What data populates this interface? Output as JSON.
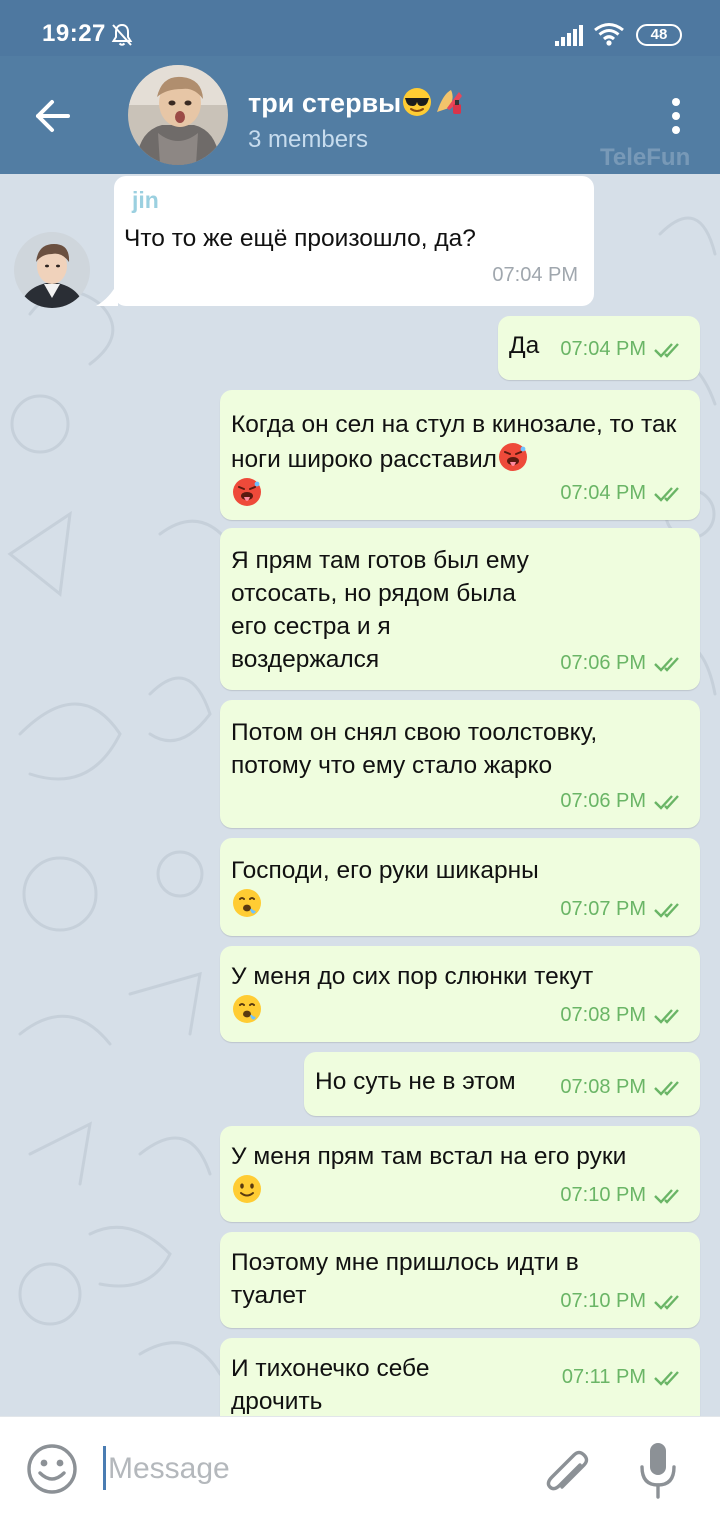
{
  "status_bar": {
    "time": "19:27",
    "battery": "48",
    "icons": [
      "bell-off-icon",
      "signal-icon",
      "wifi-icon",
      "battery-icon"
    ]
  },
  "header": {
    "title": "три стервы",
    "title_emojis": [
      "sunglasses-emoji",
      "nail-polish-emoji"
    ],
    "subtitle": "3 members",
    "watermark": "TeleFun"
  },
  "messages": [
    {
      "direction": "in",
      "sender": "jin",
      "text": "Что то же ещё произошло, да?",
      "time": "07:04 PM"
    },
    {
      "direction": "out",
      "text": "Да",
      "time": "07:04 PM",
      "read": true
    },
    {
      "direction": "out",
      "text": "Когда он сел на стул в кинозале, то так ноги широко расставил",
      "emojis": [
        "hot-face-emoji",
        "hot-face-emoji"
      ],
      "time": "07:04 PM",
      "read": true
    },
    {
      "direction": "out",
      "text": "Я прям там готов был ему отсосать, но рядом была его сестра и я воздержался",
      "time": "07:06 PM",
      "read": true
    },
    {
      "direction": "out",
      "text": "Потом он снял свою тоолстовку, потому что ему стало жарко",
      "time": "07:06 PM",
      "read": true
    },
    {
      "direction": "out",
      "text": "Господи, его руки шикарны",
      "emojis": [
        "drooling-face-emoji"
      ],
      "time": "07:07 PM",
      "read": true
    },
    {
      "direction": "out",
      "text": "У меня до сих пор слюнки текут",
      "emojis": [
        "drooling-face-emoji"
      ],
      "time": "07:08 PM",
      "read": true
    },
    {
      "direction": "out",
      "text": "Но суть не в этом",
      "time": "07:08 PM",
      "read": true
    },
    {
      "direction": "out",
      "text": "У меня прям там встал на его руки",
      "emojis": [
        "slightly-smiling-face-emoji"
      ],
      "time": "07:10 PM",
      "read": true
    },
    {
      "direction": "out",
      "text": "Поэтому мне пришлось идти в туалет",
      "time": "07:10 PM",
      "read": true
    },
    {
      "direction": "out",
      "text": "И тихонечко себе дрочить",
      "time": "07:11 PM",
      "read": true
    }
  ],
  "composer": {
    "placeholder": "Message",
    "value": ""
  },
  "colors": {
    "header": "#527da3",
    "status_bar": "#4e78a0",
    "outgoing_bubble": "#effdde",
    "incoming_bubble": "#ffffff",
    "check": "#6ab566",
    "sender_name": "#9bd0e0"
  }
}
